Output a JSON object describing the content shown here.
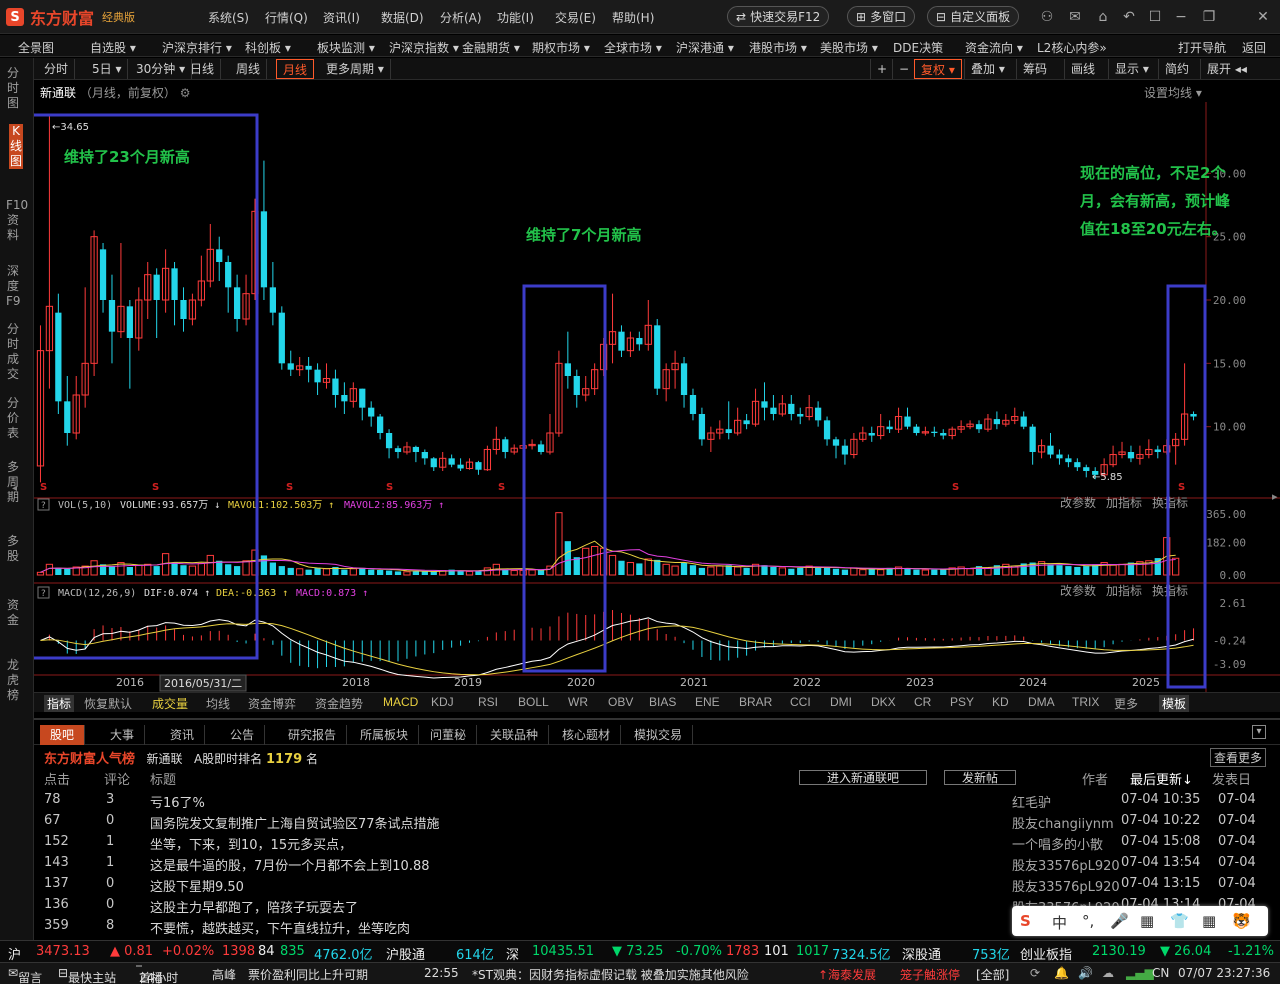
{
  "app": {
    "logo_mark": "S",
    "name": "东方财富",
    "edition": "经典版"
  },
  "menu": [
    "系统(S)",
    "行情(Q)",
    "资讯(I)",
    "数据(D)",
    "分析(A)",
    "功能(I)",
    "交易(E)",
    "帮助(H)"
  ],
  "title_buttons": {
    "quick_trade": "快速交易F12",
    "multi_window": "多窗口",
    "custom_panel": "自定义面板"
  },
  "nav": [
    "全景图",
    "自选股 ▾",
    "沪深京排行 ▾",
    "科创板 ▾",
    "板块监测 ▾",
    "沪深京指数 ▾",
    "金融期货 ▾",
    "期权市场 ▾",
    "全球市场 ▾",
    "沪深港通 ▾",
    "港股市场 ▾",
    "美股市场 ▾",
    "DDE决策",
    "资金流向 ▾",
    "L2核心内参»",
    "打开导航",
    "返回"
  ],
  "sidebar": [
    "分时图",
    "K线图",
    "F10资料",
    "深度F9",
    "分时成交",
    "分价表",
    "多周期",
    "多股",
    "资金",
    "龙虎榜"
  ],
  "chart_tabs": [
    "分时",
    "5日 ▾",
    "30分钟 ▾",
    "日线",
    "周线",
    "月线",
    "更多周期 ▾"
  ],
  "right_tools": [
    "+",
    "−",
    "复权 ▾",
    "叠加 ▾",
    "筹码",
    "画线",
    "显示 ▾",
    "简约",
    "展开 ◂◂"
  ],
  "stock": {
    "name": "新通联",
    "meta": "（月线，前复权）",
    "set_ma": "设置均线 ▾"
  },
  "annotations": {
    "left": "维持了23个月新高",
    "middle": "维持了7个月新高",
    "right_l1": "现在的高位，不足2个",
    "right_l2": "月，会有新高，预计峰",
    "right_l3": "值在18至20元左右。"
  },
  "price_marks": {
    "high": "34.65",
    "low": "5.85"
  },
  "price_axis": [
    "30.00",
    "25.00",
    "20.00",
    "15.00",
    "10.00"
  ],
  "vol_legend": {
    "title": "VOL(5,10)",
    "volume": "VOLUME:93.657万 ↓",
    "mavol1": "MAVOL1:102.503万 ↑",
    "mavol2": "MAVOL2:85.963万 ↑"
  },
  "vol_axis": [
    "365.00",
    "182.00",
    "0.00"
  ],
  "macd_legend": {
    "title": "MACD(12,26,9)",
    "dif": "DIF:0.074 ↑",
    "dea": "DEA:-0.363 ↑",
    "macd": "MACD:0.873 ↑"
  },
  "macd_axis": [
    "2.61",
    "-0.24",
    "-3.09"
  ],
  "panel_links": [
    "改参数",
    "加指标",
    "换指标"
  ],
  "years": [
    "2016",
    "2018",
    "2019",
    "2020",
    "2021",
    "2022",
    "2023",
    "2024",
    "2025"
  ],
  "cursor_date": "2016/05/31/二",
  "ind_tabs": [
    "指标",
    "恢复默认",
    "成交量",
    "均线",
    "资金博弈",
    "资金趋势",
    "MACD",
    "KDJ",
    "RSI",
    "BOLL",
    "WR",
    "OBV",
    "BIAS",
    "ENE",
    "BRAR",
    "CCI",
    "DMI",
    "DKX",
    "CR",
    "PSY",
    "KD",
    "DMA",
    "TRIX",
    "更多",
    "模板"
  ],
  "bottom_tabs": [
    "股吧",
    "大事",
    "资讯",
    "公告",
    "研究报告",
    "所属板块",
    "问董秘",
    "关联品种",
    "核心题材",
    "模拟交易"
  ],
  "popularity": {
    "title": "东方财富人气榜",
    "stock": "新通联",
    "label": "A股即时排名",
    "rank": "1179",
    "unit": "名",
    "view_more": "查看更多"
  },
  "list_header": {
    "clicks": "点击",
    "comments": "评论",
    "title": "标题",
    "enter": "进入新通联吧",
    "post": "发新帖",
    "author": "作者",
    "updated": "最后更新↓",
    "posted": "发表日"
  },
  "posts": [
    {
      "clicks": "78",
      "comments": "3",
      "title": "亏16了%",
      "author": "红毛驴",
      "updated": "07-04 10:35",
      "posted": "07-04"
    },
    {
      "clicks": "67",
      "comments": "0",
      "title": "国务院发文复制推广上海自贸试验区77条试点措施",
      "author": "股友changiiynm",
      "updated": "07-04 10:22",
      "posted": "07-04"
    },
    {
      "clicks": "152",
      "comments": "1",
      "title": "坐等，下来，到10，15元多买点，",
      "author": "一个唱多的小散",
      "updated": "07-04 15:08",
      "posted": "07-04"
    },
    {
      "clicks": "143",
      "comments": "1",
      "title": "这是最牛逼的股，7月份一个月都不会上到10.88",
      "author": "股友33576pL920",
      "updated": "07-04 13:54",
      "posted": "07-04"
    },
    {
      "clicks": "137",
      "comments": "0",
      "title": "这股下星期9.50",
      "author": "股友33576pL920",
      "updated": "07-04 13:15",
      "posted": "07-04"
    },
    {
      "clicks": "136",
      "comments": "0",
      "title": "这股主力早都跑了，陪孩子玩耍去了",
      "author": "股友33576pL920",
      "updated": "07-04 13:14",
      "posted": "07-04"
    },
    {
      "clicks": "359",
      "comments": "8",
      "title": "不要慌，越跌越买，下午直线拉升，坐等吃肉",
      "author": "",
      "updated": "",
      "posted": ""
    }
  ],
  "status": {
    "sh": "沪",
    "sh_val": "3473.13",
    "sh_chg": "▲ 0.81",
    "sh_pct": "+0.02%",
    "sh_up": "1398",
    "sh_flat": "84",
    "sh_down": "835",
    "sh_amt": "4762.0亿",
    "hgt": "沪股通",
    "hgt_amt": "614亿",
    "sz": "深",
    "sz_val": "10435.51",
    "sz_chg": "▼ 73.25",
    "sz_pct": "-0.70%",
    "sz_up": "1783",
    "sz_flat": "101",
    "sz_down": "1017",
    "sz_amt": "7324.5亿",
    "sgt": "深股通",
    "sgt_amt": "753亿",
    "cyb": "创业板指",
    "cyb_val": "2130.19",
    "cyb_chg": "▼ 26.04",
    "cyb_pct": "-1.21%"
  },
  "ticker": {
    "msg": "留言",
    "quick": "最快主站",
    "hot": "24小时",
    "tag": "首播",
    "t1": "高峰",
    "t2": "票价盈利同比上升可期",
    "time": "22:55",
    "news": "*ST观典：因财务指标虚假记载  被叠加实施其他风险",
    "n1": "↑海泰发展",
    "n2": "笼子触涨停",
    "all": "[全部]",
    "locale": "CN",
    "clock": "07/07 23:27:36"
  },
  "ime": [
    "S",
    "中",
    "°,",
    "🎤",
    "▦",
    "👕",
    "▦",
    "🐯"
  ],
  "colors": {
    "up": "#ff3b3b",
    "down": "#23d6ea",
    "annotation": "#22c24a",
    "box": "#3c3cc8",
    "accent": "#c7481f"
  },
  "chart_data": {
    "type": "candlestick",
    "period": "monthly",
    "note_values_estimated": true,
    "candles": [
      [
        6.9,
        16.0,
        5.6,
        18.0
      ],
      [
        16.0,
        19.5,
        13.0,
        34.65
      ],
      [
        19.0,
        12.0,
        11.0,
        20.5
      ],
      [
        12.0,
        9.5,
        8.5,
        14.0
      ],
      [
        9.5,
        12.5,
        9.0,
        14.0
      ],
      [
        12.5,
        15.0,
        11.5,
        21.0
      ],
      [
        15.0,
        25.0,
        14.0,
        25.5
      ],
      [
        24.0,
        20.0,
        19.0,
        24.5
      ],
      [
        20.0,
        17.5,
        15.0,
        22.0
      ],
      [
        17.5,
        19.5,
        17.0,
        24.5
      ],
      [
        19.5,
        17.0,
        13.0,
        20.0
      ],
      [
        17.0,
        20.0,
        16.0,
        21.0
      ],
      [
        20.0,
        22.0,
        18.5,
        23.0
      ],
      [
        22.0,
        20.0,
        17.0,
        22.5
      ],
      [
        20.0,
        22.5,
        19.0,
        24.0
      ],
      [
        22.5,
        20.0,
        18.0,
        23.0
      ],
      [
        20.0,
        18.5,
        17.5,
        21.0
      ],
      [
        18.5,
        20.0,
        18.0,
        20.5
      ],
      [
        20.0,
        21.5,
        19.5,
        23.5
      ],
      [
        21.5,
        24.0,
        21.0,
        26.0
      ],
      [
        24.0,
        23.0,
        21.5,
        25.0
      ],
      [
        23.0,
        21.0,
        19.0,
        23.5
      ],
      [
        21.0,
        18.5,
        17.5,
        22.0
      ],
      [
        18.5,
        20.5,
        18.0,
        22.0
      ],
      [
        20.5,
        27.0,
        20.0,
        28.0
      ],
      [
        27.0,
        21.0,
        20.0,
        31.0
      ],
      [
        21.0,
        19.0,
        18.0,
        23.0
      ],
      [
        19.0,
        15.0,
        14.5,
        19.5
      ],
      [
        15.0,
        14.5,
        14.0,
        16.0
      ],
      [
        14.5,
        14.8,
        14.0,
        15.5
      ],
      [
        14.8,
        14.5,
        13.5,
        15.5
      ],
      [
        14.5,
        13.5,
        12.5,
        15.0
      ],
      [
        13.5,
        13.8,
        13.0,
        15.0
      ],
      [
        13.8,
        12.5,
        11.5,
        14.5
      ],
      [
        12.5,
        12.0,
        11.0,
        13.5
      ],
      [
        12.0,
        13.0,
        11.5,
        13.5
      ],
      [
        13.0,
        11.5,
        10.5,
        13.0
      ],
      [
        11.5,
        10.8,
        10.0,
        12.0
      ],
      [
        10.8,
        9.5,
        9.0,
        11.0
      ],
      [
        9.5,
        8.3,
        7.5,
        9.8
      ],
      [
        8.3,
        8.0,
        7.5,
        8.5
      ],
      [
        8.0,
        8.4,
        7.8,
        8.8
      ],
      [
        8.4,
        8.0,
        7.2,
        8.5
      ],
      [
        8.0,
        7.5,
        7.0,
        8.2
      ],
      [
        7.5,
        6.8,
        6.5,
        7.6
      ],
      [
        6.8,
        7.5,
        6.5,
        8.0
      ],
      [
        7.5,
        7.0,
        6.8,
        7.8
      ],
      [
        7.0,
        6.7,
        6.5,
        7.5
      ],
      [
        6.7,
        7.2,
        6.6,
        7.5
      ],
      [
        7.2,
        6.6,
        6.2,
        7.3
      ],
      [
        6.6,
        8.2,
        6.5,
        8.5
      ],
      [
        8.2,
        9.0,
        7.8,
        10.0
      ],
      [
        9.0,
        8.0,
        7.5,
        9.2
      ],
      [
        8.0,
        8.3,
        7.8,
        8.6
      ],
      [
        8.3,
        8.5,
        8.0,
        8.8
      ],
      [
        8.5,
        8.6,
        8.2,
        9.0
      ],
      [
        8.6,
        8.0,
        7.8,
        8.9
      ],
      [
        8.0,
        9.5,
        7.8,
        11.0
      ],
      [
        9.5,
        15.0,
        9.2,
        16.0
      ],
      [
        15.0,
        14.0,
        13.0,
        17.5
      ],
      [
        14.0,
        12.5,
        11.5,
        14.5
      ],
      [
        12.5,
        13.0,
        12.0,
        14.0
      ],
      [
        13.0,
        14.5,
        12.5,
        15.0
      ],
      [
        14.5,
        16.5,
        14.0,
        17.0
      ],
      [
        16.5,
        17.5,
        15.0,
        20.5
      ],
      [
        17.5,
        16.0,
        15.5,
        18.0
      ],
      [
        16.0,
        17.0,
        15.5,
        17.5
      ],
      [
        17.0,
        16.5,
        16.0,
        17.5
      ],
      [
        16.5,
        18.0,
        16.0,
        20.0
      ],
      [
        18.0,
        13.0,
        12.5,
        18.5
      ],
      [
        13.0,
        14.5,
        12.0,
        15.0
      ],
      [
        14.5,
        15.0,
        13.0,
        16.0
      ],
      [
        15.0,
        12.5,
        11.5,
        15.5
      ],
      [
        12.5,
        11.0,
        10.5,
        13.0
      ],
      [
        11.0,
        9.0,
        8.5,
        11.5
      ],
      [
        9.0,
        9.5,
        8.0,
        10.0
      ],
      [
        9.5,
        9.8,
        9.0,
        10.5
      ],
      [
        9.8,
        9.5,
        9.0,
        12.0
      ],
      [
        9.5,
        10.5,
        9.3,
        11.5
      ],
      [
        10.5,
        10.2,
        9.8,
        11.0
      ],
      [
        10.2,
        12.0,
        10.0,
        13.0
      ],
      [
        12.0,
        11.5,
        10.5,
        13.5
      ],
      [
        11.5,
        11.0,
        10.5,
        12.5
      ],
      [
        11.0,
        11.8,
        10.8,
        12.5
      ],
      [
        11.8,
        11.0,
        10.5,
        12.5
      ],
      [
        11.0,
        10.8,
        10.2,
        11.5
      ],
      [
        10.8,
        11.5,
        10.5,
        12.5
      ],
      [
        11.5,
        10.5,
        10.0,
        12.0
      ],
      [
        10.5,
        9.0,
        8.5,
        10.8
      ],
      [
        9.0,
        8.5,
        7.5,
        9.2
      ],
      [
        8.5,
        7.8,
        7.0,
        9.0
      ],
      [
        7.8,
        9.0,
        7.5,
        9.5
      ],
      [
        9.0,
        9.5,
        8.8,
        10.0
      ],
      [
        9.5,
        9.3,
        8.8,
        10.0
      ],
      [
        9.3,
        10.0,
        9.0,
        11.0
      ],
      [
        10.0,
        9.8,
        9.5,
        10.5
      ],
      [
        9.8,
        10.8,
        9.5,
        11.5
      ],
      [
        10.8,
        10.0,
        9.8,
        11.5
      ],
      [
        10.0,
        9.5,
        9.3,
        10.2
      ],
      [
        9.5,
        9.6,
        9.3,
        10.0
      ],
      [
        9.6,
        9.5,
        9.2,
        10.0
      ],
      [
        9.5,
        9.3,
        9.0,
        9.8
      ],
      [
        9.3,
        9.8,
        9.0,
        10.0
      ],
      [
        9.8,
        10.0,
        9.5,
        10.5
      ],
      [
        10.0,
        10.2,
        9.8,
        10.5
      ],
      [
        10.2,
        9.8,
        9.5,
        10.5
      ],
      [
        9.8,
        10.6,
        9.6,
        11.0
      ],
      [
        10.6,
        10.2,
        9.8,
        11.2
      ],
      [
        10.2,
        10.5,
        10.0,
        11.0
      ],
      [
        10.5,
        10.8,
        10.2,
        11.5
      ],
      [
        10.8,
        10.0,
        9.8,
        11.2
      ],
      [
        10.0,
        8.0,
        7.0,
        10.2
      ],
      [
        8.0,
        8.5,
        7.5,
        9.0
      ],
      [
        8.5,
        7.8,
        7.5,
        9.5
      ],
      [
        7.8,
        7.5,
        7.0,
        8.2
      ],
      [
        7.5,
        7.2,
        6.8,
        7.8
      ],
      [
        7.2,
        6.8,
        6.5,
        7.5
      ],
      [
        6.8,
        6.5,
        6.0,
        7.0
      ],
      [
        6.5,
        6.2,
        5.85,
        6.8
      ],
      [
        6.2,
        7.0,
        6.0,
        7.5
      ],
      [
        7.0,
        7.8,
        6.8,
        8.5
      ],
      [
        7.8,
        8.0,
        7.5,
        8.8
      ],
      [
        8.0,
        7.5,
        7.2,
        8.5
      ],
      [
        7.5,
        7.8,
        7.0,
        8.5
      ],
      [
        7.8,
        8.2,
        7.5,
        9.0
      ],
      [
        8.2,
        8.0,
        7.5,
        8.5
      ],
      [
        8.0,
        8.5,
        7.8,
        9.0
      ],
      [
        8.5,
        9.0,
        7.0,
        9.5
      ],
      [
        9.0,
        11.0,
        8.5,
        15.0
      ],
      [
        11.0,
        10.8,
        10.5,
        11.2
      ]
    ],
    "volume": [
      15,
      60,
      40,
      35,
      45,
      50,
      80,
      60,
      50,
      70,
      45,
      55,
      60,
      50,
      120,
      70,
      55,
      50,
      65,
      110,
      80,
      60,
      50,
      80,
      140,
      110,
      70,
      50,
      40,
      35,
      30,
      40,
      35,
      45,
      30,
      35,
      40,
      30,
      28,
      25,
      20,
      18,
      20,
      22,
      20,
      25,
      30,
      25,
      20,
      22,
      40,
      60,
      30,
      25,
      25,
      28,
      30,
      50,
      350,
      190,
      100,
      150,
      160,
      150,
      110,
      80,
      70,
      65,
      90,
      85,
      60,
      50,
      70,
      55,
      40,
      45,
      50,
      55,
      45,
      40,
      60,
      55,
      45,
      40,
      35,
      40,
      50,
      45,
      40,
      35,
      30,
      40,
      30,
      35,
      30,
      40,
      45,
      35,
      30,
      28,
      30,
      35,
      40,
      45,
      35,
      50,
      40,
      55,
      60,
      50,
      65,
      70,
      75,
      60,
      55,
      50,
      45,
      50,
      60,
      70,
      55,
      60,
      70,
      75,
      80,
      95,
      210,
      94
    ],
    "volume_axis": [
      0,
      365
    ],
    "price_axis": [
      5,
      35
    ],
    "x_years": [
      "2016",
      "2018",
      "2019",
      "2020",
      "2021",
      "2022",
      "2023",
      "2024",
      "2025"
    ]
  }
}
